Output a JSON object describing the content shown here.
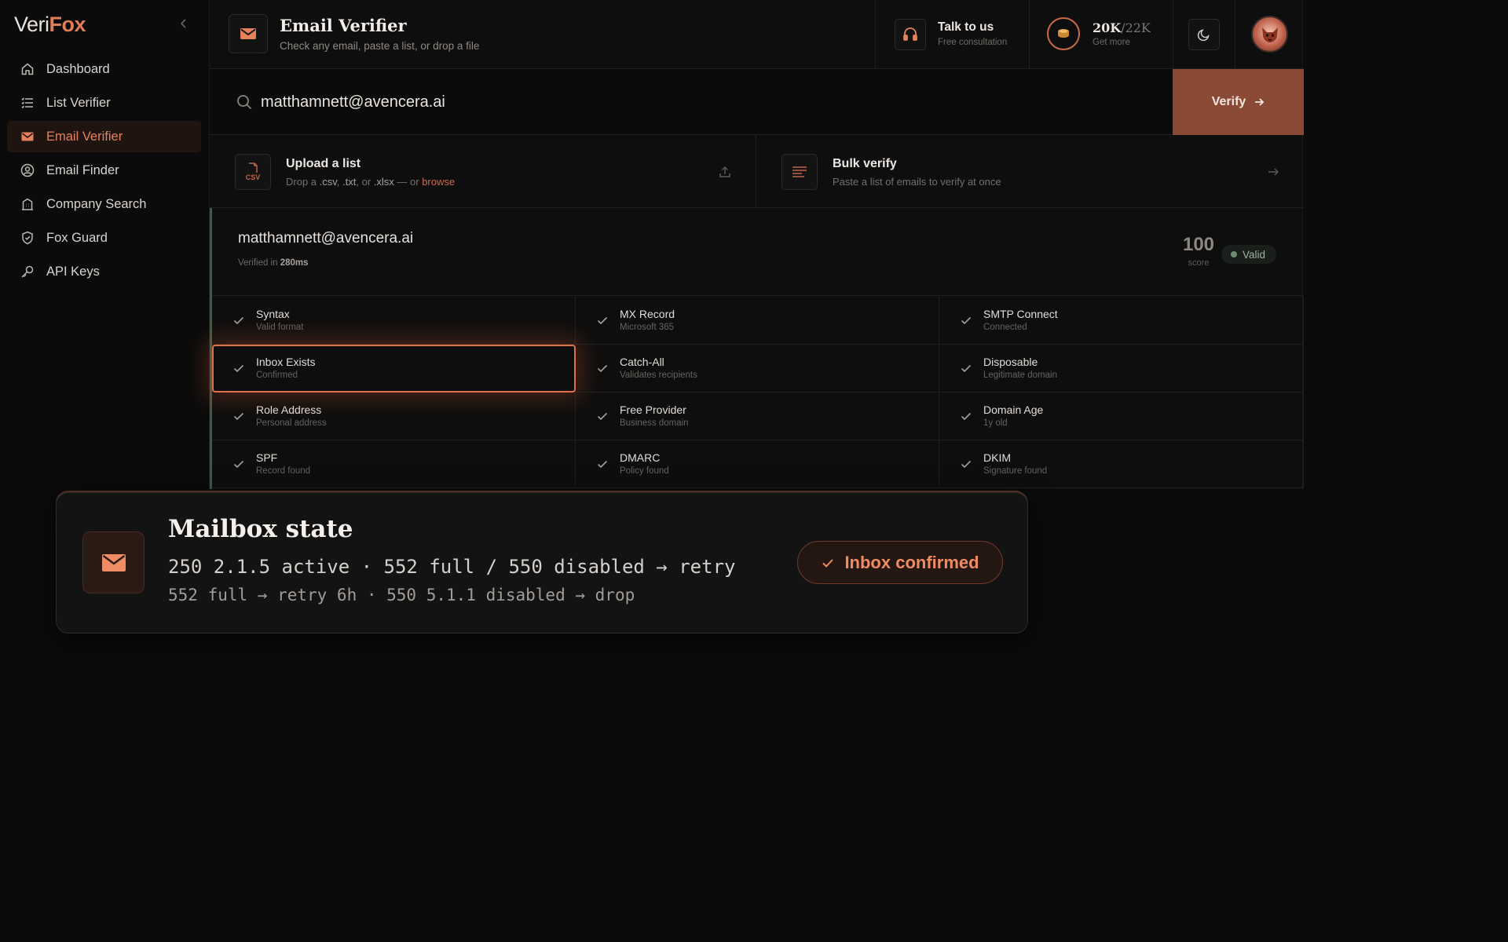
{
  "app": {
    "logo_part1": "Veri",
    "logo_part2": "Fox"
  },
  "sidebar": {
    "items": [
      {
        "label": "Dashboard",
        "icon": "home-icon"
      },
      {
        "label": "List Verifier",
        "icon": "list-icon"
      },
      {
        "label": "Email Verifier",
        "icon": "mail-icon",
        "active": true
      },
      {
        "label": "Email Finder",
        "icon": "user-search-icon"
      },
      {
        "label": "Company Search",
        "icon": "building-icon"
      },
      {
        "label": "Fox Guard",
        "icon": "shield-check-icon"
      },
      {
        "label": "API Keys",
        "icon": "key-icon"
      }
    ]
  },
  "header": {
    "title": "Email Verifier",
    "subtitle": "Check any email, paste a list, or drop a file",
    "talk_title": "Talk to us",
    "talk_sub": "Free consultation",
    "credits_used": "20K",
    "credits_total": "/22K",
    "credits_sub": "Get more"
  },
  "search": {
    "value": "matthamnett@avencera.ai",
    "button_label": "Verify"
  },
  "upload": {
    "title": "Upload a list",
    "icon_label": "CSV",
    "sub_prefix": "Drop a ",
    "ext1": ".csv",
    "sep1": ", ",
    "ext2": ".txt",
    "sep2": ", or ",
    "ext3": ".xlsx",
    "sub_mid": " — or ",
    "browse": "browse"
  },
  "bulk": {
    "title": "Bulk verify",
    "subtitle": "Paste a list of emails to verify at once"
  },
  "result": {
    "email": "matthamnett@avencera.ai",
    "time_prefix": "Verified in ",
    "time_value": "280ms",
    "score": "100",
    "score_label": "score",
    "status": "Valid",
    "checks": [
      {
        "label": "Syntax",
        "sub": "Valid format"
      },
      {
        "label": "MX Record",
        "sub": "Microsoft 365"
      },
      {
        "label": "SMTP Connect",
        "sub": "Connected"
      },
      {
        "label": "Inbox Exists",
        "sub": "Confirmed",
        "highlight": true
      },
      {
        "label": "Catch-All",
        "sub": "Validates recipients"
      },
      {
        "label": "Disposable",
        "sub": "Legitimate domain"
      },
      {
        "label": "Role Address",
        "sub": "Personal address"
      },
      {
        "label": "Free Provider",
        "sub": "Business domain"
      },
      {
        "label": "Domain Age",
        "sub": "1y old"
      },
      {
        "label": "SPF",
        "sub": "Record found"
      },
      {
        "label": "DMARC",
        "sub": "Policy found"
      },
      {
        "label": "DKIM",
        "sub": "Signature found"
      }
    ]
  },
  "popup": {
    "title": "Mailbox state",
    "line1": "250 2.1.5 active · 552 full / 550 disabled → retry",
    "line2": "552 full → retry 6h · 550 5.1.1 disabled → drop",
    "badge": "Inbox confirmed"
  },
  "colors": {
    "accent": "#e5815c",
    "verify_button": "#8b4a36",
    "valid_bar": "#3f5b45",
    "background": "#0b0b0b"
  }
}
